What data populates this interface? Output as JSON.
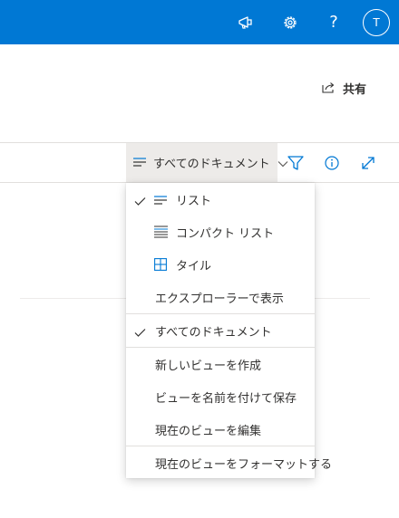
{
  "suitebar": {
    "icons": [
      "megaphone-icon",
      "gear-icon",
      "help-icon"
    ],
    "help_glyph": "?",
    "avatar_initial": "T",
    "accent_color": "#0078d4"
  },
  "share": {
    "label": "共有",
    "icon": "share-icon"
  },
  "command_bar": {
    "view_label": "すべてのドキュメント",
    "icons": [
      "filter-icon",
      "info-icon",
      "expand-icon"
    ],
    "icon_color": "#0078d4"
  },
  "view_menu": {
    "items": [
      {
        "label": "リスト",
        "checked": true,
        "icon": "list-icon"
      },
      {
        "label": "コンパクト リスト",
        "checked": false,
        "icon": "compact-list-icon"
      },
      {
        "label": "タイル",
        "checked": false,
        "icon": "tiles-icon"
      },
      {
        "label": "エクスプローラーで表示",
        "checked": false
      },
      {
        "label": "すべてのドキュメント",
        "checked": true
      },
      {
        "label": "新しいビューを作成",
        "checked": false
      },
      {
        "label": "ビューを名前を付けて保存",
        "checked": false
      },
      {
        "label": "現在のビューを編集",
        "checked": false
      },
      {
        "label": "現在のビューをフォーマットする",
        "checked": false
      }
    ]
  }
}
